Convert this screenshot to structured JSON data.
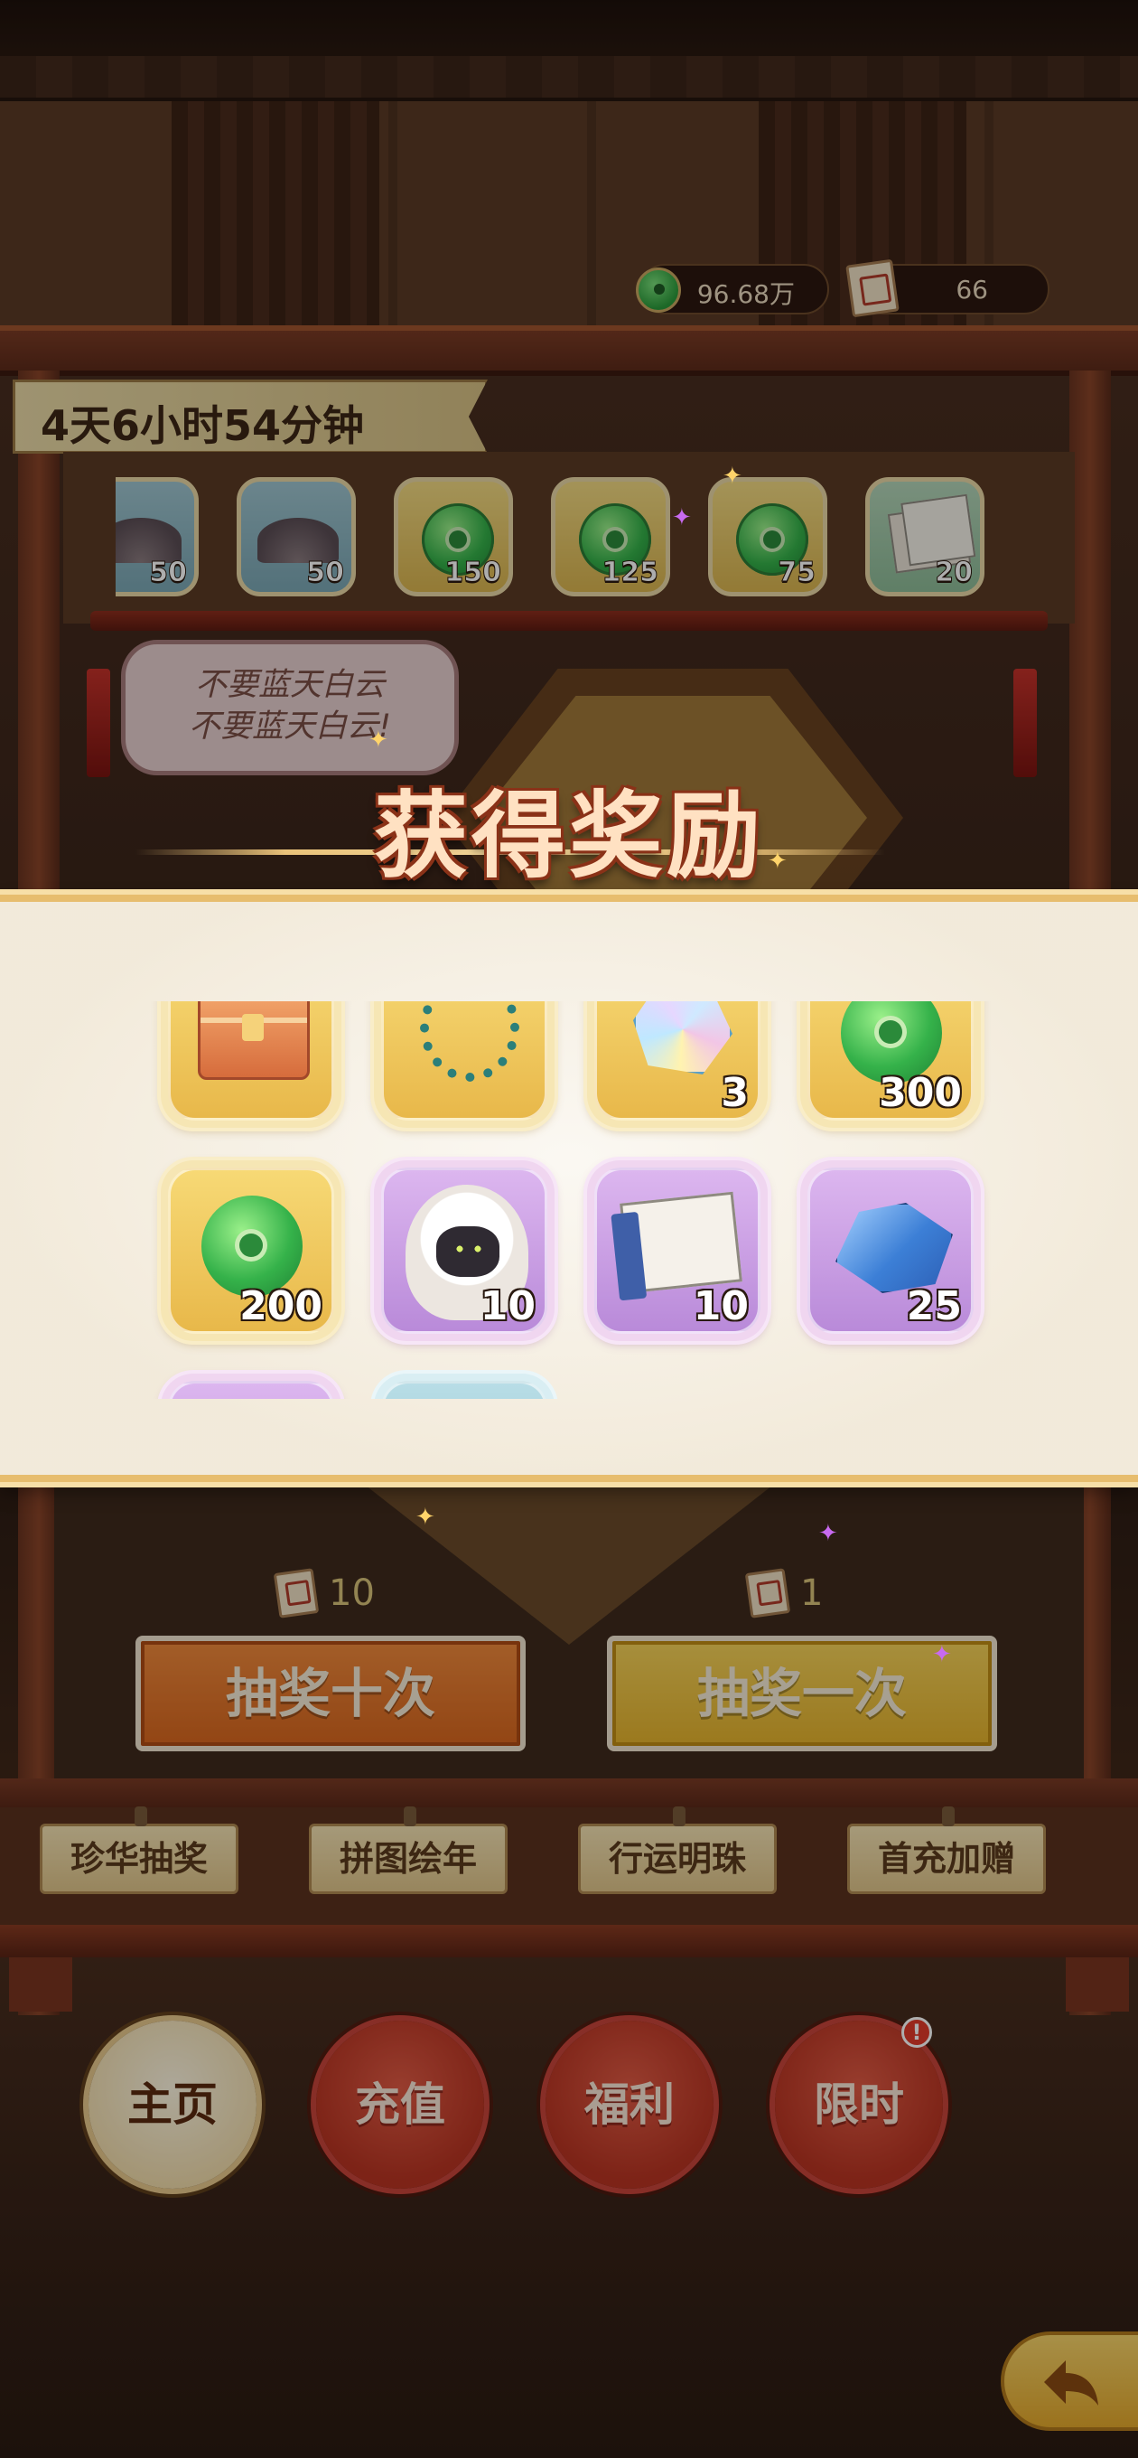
{
  "currency": {
    "jade_amount": "96.68万",
    "ticket_amount": "66"
  },
  "timer": "4天6小时54分钟",
  "shop_items": [
    {
      "icon": "sand-icon",
      "qty": "50",
      "style": "blue"
    },
    {
      "icon": "sand-icon",
      "qty": "50",
      "style": "blue"
    },
    {
      "icon": "jade-icon",
      "qty": "150",
      "style": "gold"
    },
    {
      "icon": "jade-icon",
      "qty": "125",
      "style": "gold"
    },
    {
      "icon": "jade-icon",
      "qty": "75",
      "style": "gold"
    },
    {
      "icon": "scroll-icon",
      "qty": "20",
      "style": "green"
    }
  ],
  "speech": {
    "line1": "不要蓝天白云",
    "line2": "不要蓝天白云!"
  },
  "reward_popup": {
    "title": "获得奖励",
    "items": [
      {
        "icon": "chest-icon",
        "qty": "",
        "rarity": "gold"
      },
      {
        "icon": "necklace-icon",
        "qty": "",
        "rarity": "gold"
      },
      {
        "icon": "gem-icon",
        "qty": "3",
        "rarity": "gold"
      },
      {
        "icon": "jade-icon",
        "qty": "300",
        "rarity": "gold"
      },
      {
        "icon": "jade-icon",
        "qty": "200",
        "rarity": "gold"
      },
      {
        "icon": "sheep-icon",
        "qty": "10",
        "rarity": "purple"
      },
      {
        "icon": "book-icon",
        "qty": "10",
        "rarity": "purple"
      },
      {
        "icon": "crystal-icon",
        "qty": "25",
        "rarity": "purple"
      },
      {
        "icon": "item-icon",
        "qty": "",
        "rarity": "purple"
      },
      {
        "icon": "item-icon",
        "qty": "",
        "rarity": "blue"
      }
    ]
  },
  "draw": {
    "ten_cost": "10",
    "ten_label": "抽奖十次",
    "one_cost": "1",
    "one_label": "抽奖一次"
  },
  "tabs": [
    "珍华抽奖",
    "拼图绘年",
    "行运明珠",
    "首充加赠"
  ],
  "nav": [
    "主页",
    "充值",
    "福利",
    "限时"
  ],
  "colors": {
    "jade_green": "#35b24a",
    "gold_card": "#f7d975",
    "purple_card": "#dcb6ef",
    "title_text": "#ffe1c2",
    "nav_red": "#c8443a"
  }
}
